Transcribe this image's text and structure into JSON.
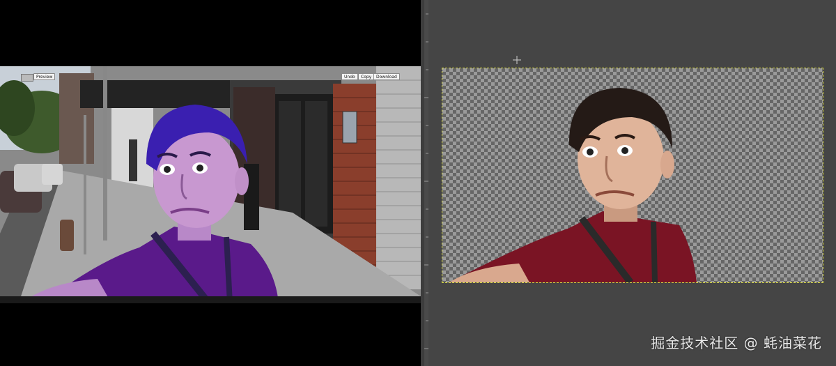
{
  "left_tool": {
    "preview_label": "Preview",
    "toolbar": {
      "undo_label": "Undo",
      "copy_label": "Copy",
      "download_label": "Download"
    }
  },
  "right_editor": {
    "canvas": "transparent-checkerboard"
  },
  "watermark": "掘金技术社区 @ 蚝油菜花",
  "icons": {
    "crosshair": "crosshair-icon"
  },
  "colors": {
    "selection_outline": "#d6d640",
    "shirt_purple": "#5a1a8a",
    "shirt_red": "#7a1424",
    "editor_bg": "#454545"
  }
}
